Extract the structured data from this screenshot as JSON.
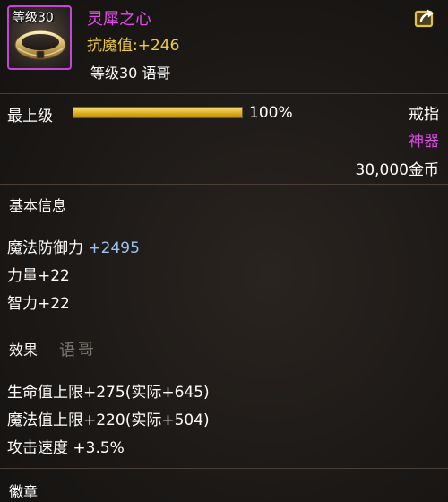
{
  "item": {
    "icon_level": "等级30",
    "name": "灵犀之心",
    "resist_label": "抗魔值:",
    "resist_value": "+246",
    "level_owner": "等级30 语哥",
    "icon": "ring-icon",
    "share_icon": "share-icon"
  },
  "upgrade": {
    "label": "最上级",
    "progress": 1.0,
    "progress_text": "100%",
    "type": "戒指",
    "quality": "神器",
    "price": "30,000金币"
  },
  "basic_info": {
    "title": "基本信息",
    "stats": [
      {
        "label": "魔法防御力 ",
        "value": "+2495"
      },
      {
        "label": "力量",
        "value": "+22"
      },
      {
        "label": "智力",
        "value": "+22"
      }
    ]
  },
  "effects": {
    "title": "效果",
    "handwritten": "语哥",
    "lines": [
      "生命值上限+275(实际+645)",
      "魔法值上限+220(实际+504)",
      "攻击速度 +3.5%"
    ]
  },
  "badge": {
    "title": "徽章"
  },
  "colors": {
    "epic_purple": "#e04ae8",
    "gold": "#f0cc3c",
    "blue_value": "#9cc2ee"
  }
}
